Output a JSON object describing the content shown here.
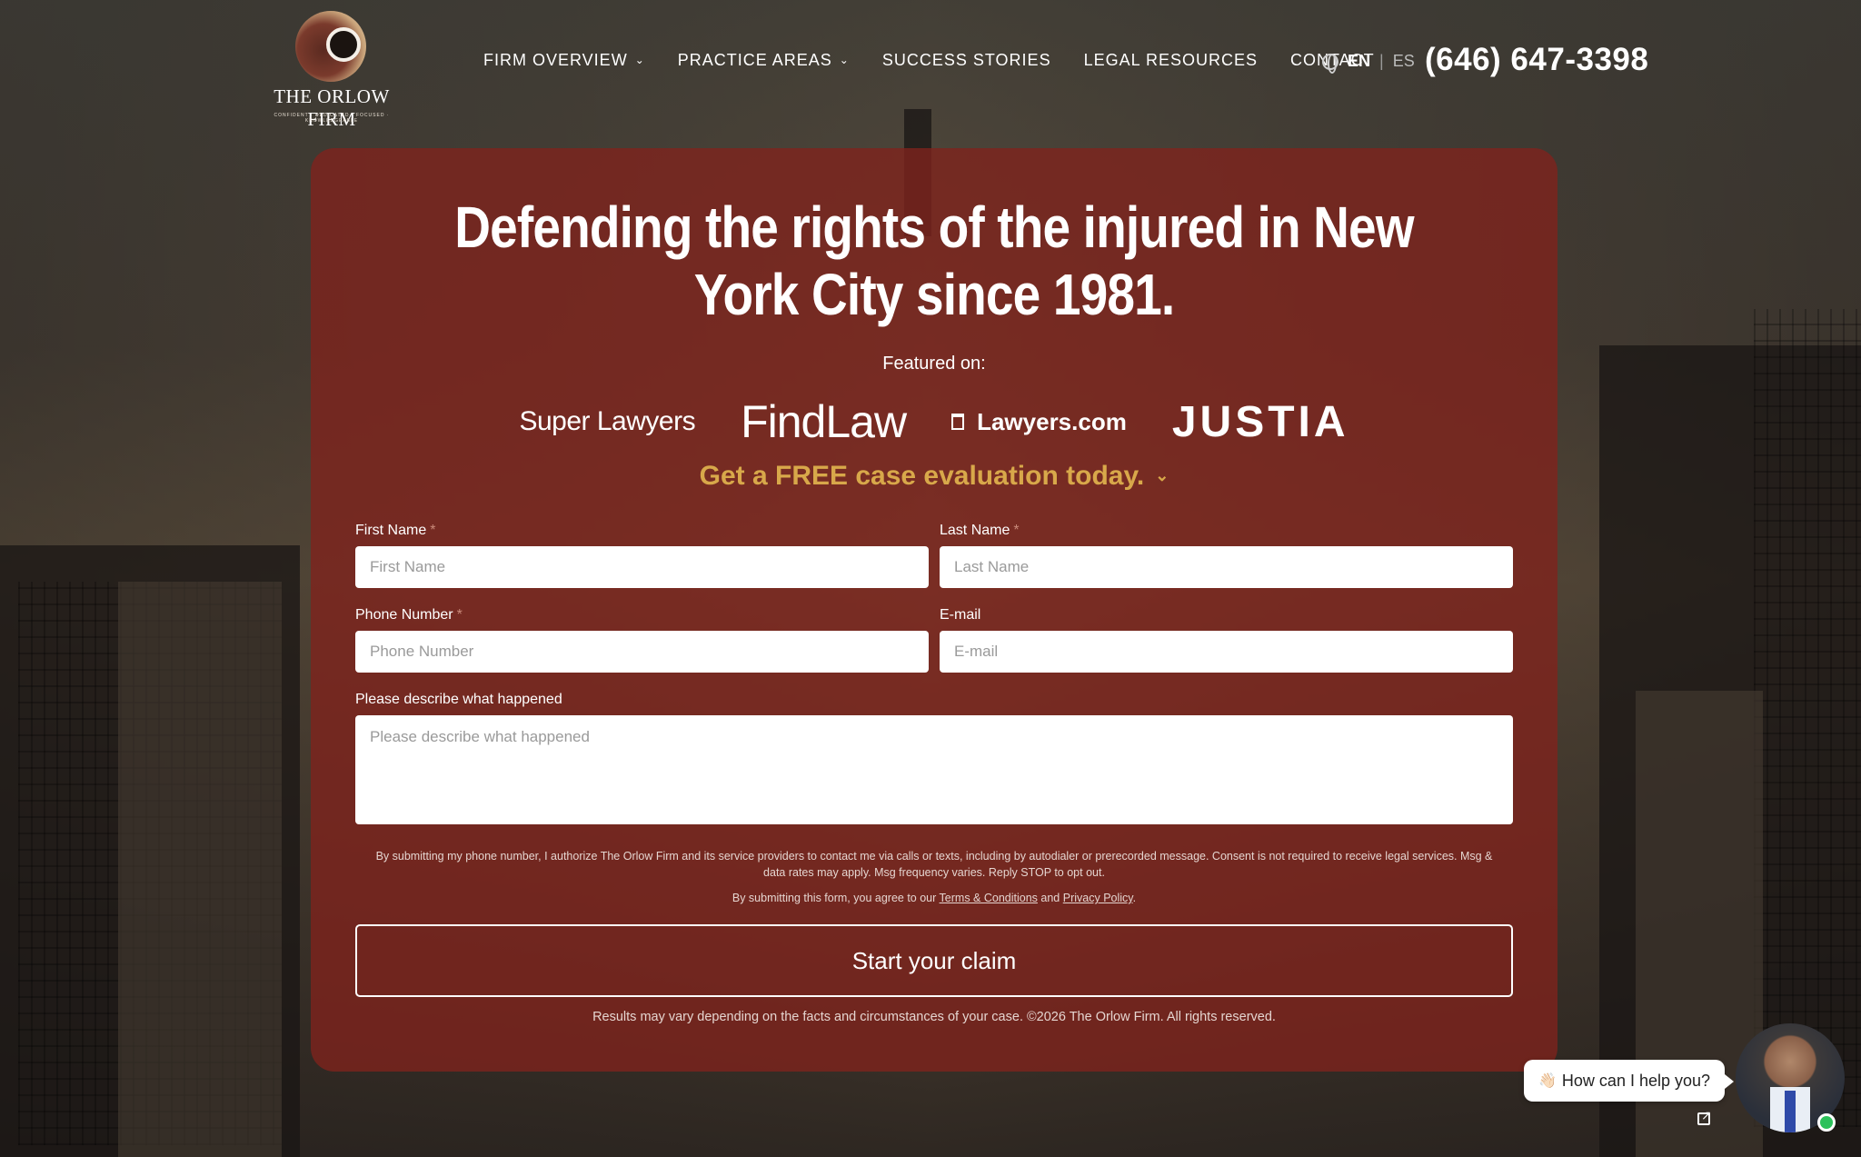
{
  "header": {
    "logo_title": "THE ORLOW FIRM",
    "logo_tagline": "CONFIDENT · DEDICATED · FOCUSED · KNOWLEDGEABLE",
    "nav": [
      {
        "label": "FIRM OVERVIEW",
        "has_dropdown": true
      },
      {
        "label": "PRACTICE AREAS",
        "has_dropdown": true
      },
      {
        "label": "SUCCESS STORIES",
        "has_dropdown": false
      },
      {
        "label": "LEGAL RESOURCES",
        "has_dropdown": false
      },
      {
        "label": "CONTACT",
        "has_dropdown": false
      }
    ],
    "lang_active": "EN",
    "lang_separator": "|",
    "lang_other": "ES",
    "phone": "(646) 647-3398"
  },
  "hero": {
    "headline": "Defending the rights of the injured in New York City since 1981.",
    "featured_label": "Featured on:",
    "featured_logos": [
      "Super Lawyers",
      "FindLaw",
      "Lawyers.com",
      "JUSTIA"
    ],
    "eval_text": "Get a FREE case evaluation today."
  },
  "form": {
    "first_name": {
      "label": "First Name",
      "placeholder": "First Name",
      "required": true,
      "value": ""
    },
    "last_name": {
      "label": "Last Name",
      "placeholder": "Last Name",
      "required": true,
      "value": ""
    },
    "phone": {
      "label": "Phone Number",
      "placeholder": "Phone Number",
      "required": true,
      "value": ""
    },
    "email": {
      "label": "E-mail",
      "placeholder": "E-mail",
      "required": false,
      "value": ""
    },
    "description": {
      "label": "Please describe what happened",
      "placeholder": "Please describe what happened",
      "value": ""
    },
    "required_marker": "*",
    "consent": "By submitting my phone number, I authorize The Orlow Firm and its service providers to contact me via calls or texts, including by autodialer or prerecorded message. Consent is not required to receive legal services. Msg & data rates may apply. Msg frequency varies. Reply STOP to opt out.",
    "agree_prefix": "By submitting this form, you agree to our",
    "terms_link": "Terms & Conditions",
    "agree_and": "and",
    "privacy_link": "Privacy Policy",
    "agree_suffix": ".",
    "submit_label": "Start your claim",
    "disclaimer": "Results may vary depending on the facts and circumstances of your case. ©2026 The Orlow Firm. All rights reserved."
  },
  "chat": {
    "wave": "👋🏻",
    "prompt": "How can I help you?",
    "status": "online"
  },
  "colors": {
    "card_bg": "#80221c",
    "accent_gold": "#d8a84a",
    "online": "#2bc15a"
  }
}
